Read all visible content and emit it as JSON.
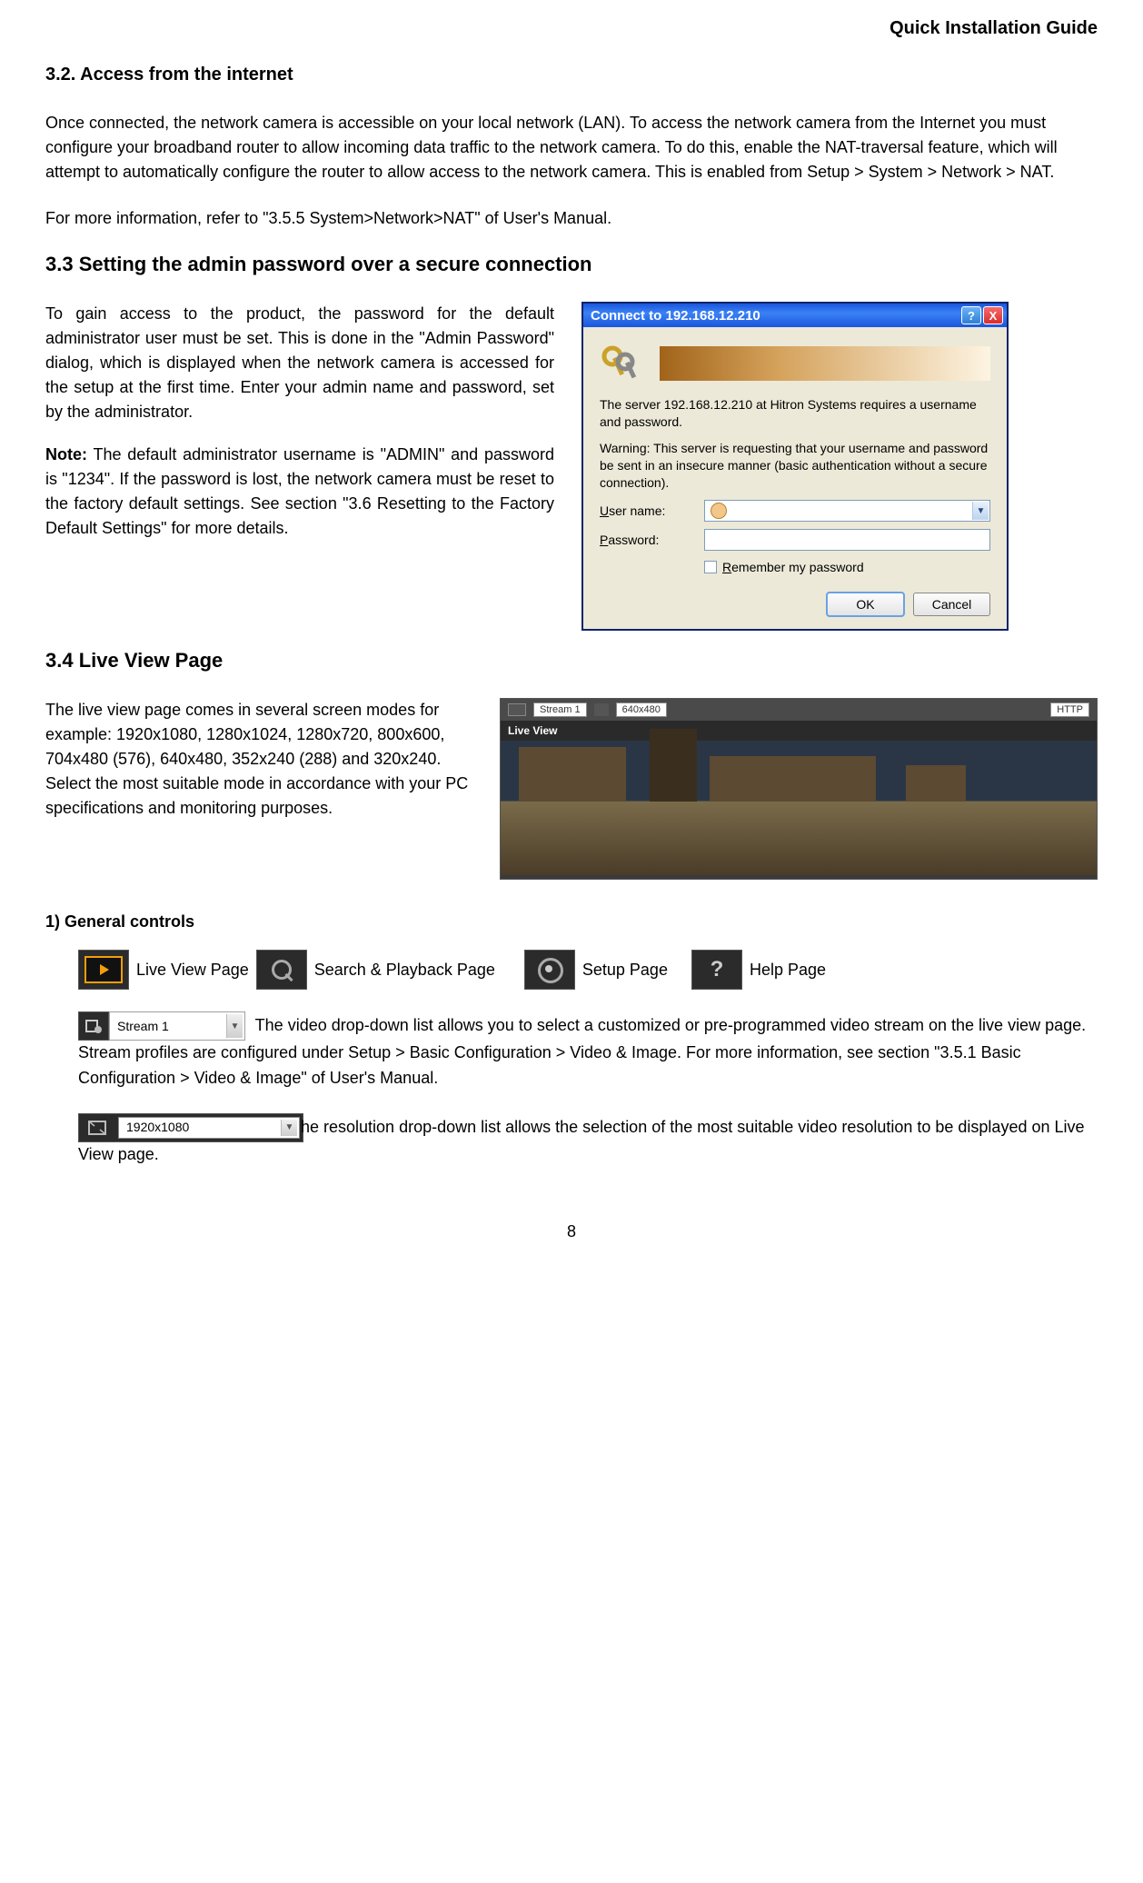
{
  "header": {
    "title": "Quick Installation Guide"
  },
  "section32": {
    "heading": "3.2. Access from the internet",
    "para1": "Once connected, the network camera is accessible on your local network (LAN). To access the network camera from the Internet you must configure your broadband router to allow incoming data traffic to the network camera. To do this, enable the NAT-traversal feature, which will attempt to automatically configure the router to allow access to the network camera. This is enabled from Setup > System > Network > NAT.",
    "para2": "For more information, refer to \"3.5.5 System>Network>NAT\" of User's Manual."
  },
  "section33": {
    "heading": "3.3 Setting the admin password over a secure connection",
    "para1": "To gain access to the product, the password for the default administrator user must be set. This is done in the \"Admin Password\" dialog, which is displayed when the network camera is accessed for the setup at the first time. Enter your admin name and password, set by the administrator.",
    "noteLabel": "Note:",
    "notePara": " The default administrator username is \"ADMIN\" and password is \"1234\". If the password is lost, the network camera must be reset to the factory default settings. See section \"3.6 Resetting to the Factory Default Settings\" for more details.",
    "dialog": {
      "title": "Connect to 192.168.12.210",
      "serverText": "The server 192.168.12.210 at Hitron Systems requires a username and password.",
      "warning": "Warning: This server is requesting that your username and password be sent in an insecure manner (basic authentication without a secure connection).",
      "userLabelPre": "U",
      "userLabelPost": "ser name:",
      "passLabelPre": "P",
      "passLabelPost": "assword:",
      "rememberPre": "R",
      "rememberPost": "emember my password",
      "ok": "OK",
      "cancel": "Cancel"
    }
  },
  "section34": {
    "heading": "3.4 Live View Page",
    "para": "The live view page comes in several screen modes for example: 1920x1080, 1280x1024, 1280x720, 800x600, 704x480 (576), 640x480, 352x240 (288) and 320x240. Select the most suitable mode in accordance with your PC specifications and monitoring purposes.",
    "liveview": {
      "label": "Live View",
      "stream": "Stream 1",
      "res": "640x480",
      "proto": "HTTP"
    }
  },
  "general": {
    "heading": "1)   General controls",
    "liveview": "Live View Page",
    "search": "Search & Playback Page",
    "setup": "Setup Page",
    "help": "Help Page",
    "streamDropdown": "Stream 1",
    "resDropdown": "1920x1080",
    "streamPara": " The video drop-down list allows you to select a customized or pre-programmed video stream on the live view page. Stream profiles are configured under Setup > Basic Configuration > Video & Image. For more information, see section \"3.5.1 Basic Configuration > Video & Image\" of User's Manual.",
    "resPara": "he resolution drop-down list allows the selection of the most suitable video resolution to be displayed on Live View page."
  },
  "footer": {
    "pageNum": "8"
  }
}
